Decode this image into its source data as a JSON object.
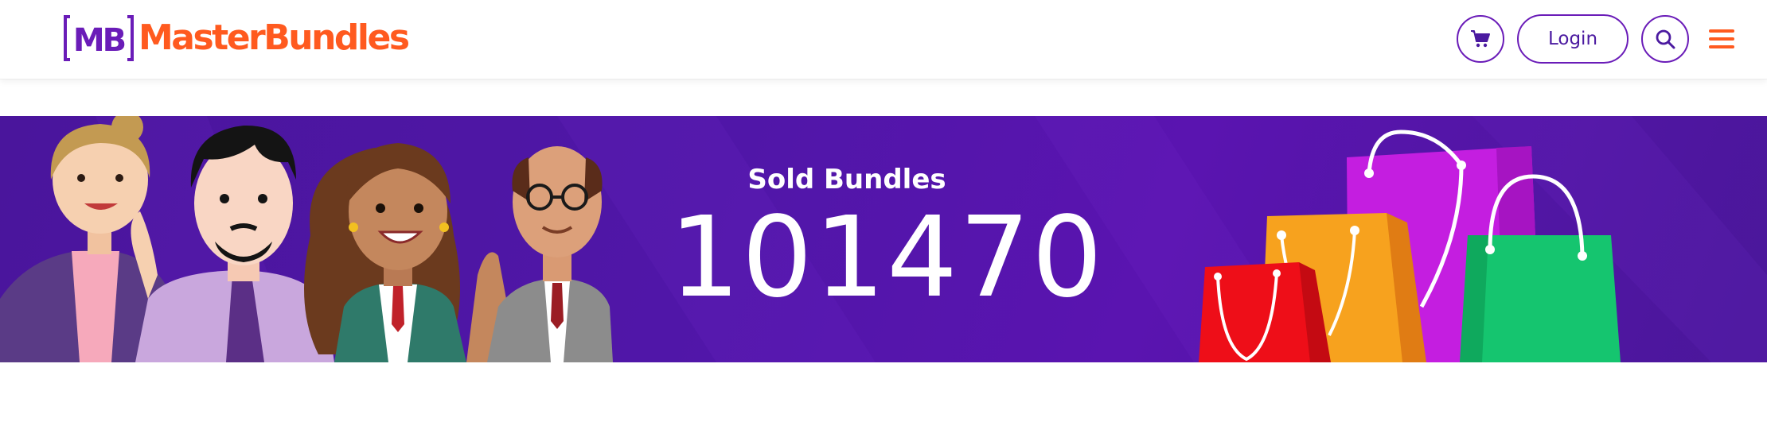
{
  "header": {
    "logo": {
      "mark_text": "MB",
      "brand_name": "MasterBundles"
    },
    "login_label": "Login",
    "icons": {
      "cart": "cart-icon",
      "search": "search-icon",
      "menu": "hamburger-menu-icon"
    }
  },
  "banner": {
    "label": "Sold Bundles",
    "value": "101470"
  },
  "colors": {
    "brand_orange": "#ff5a1f",
    "brand_purple": "#6a1cb8",
    "banner_bg": "#5016a8"
  }
}
